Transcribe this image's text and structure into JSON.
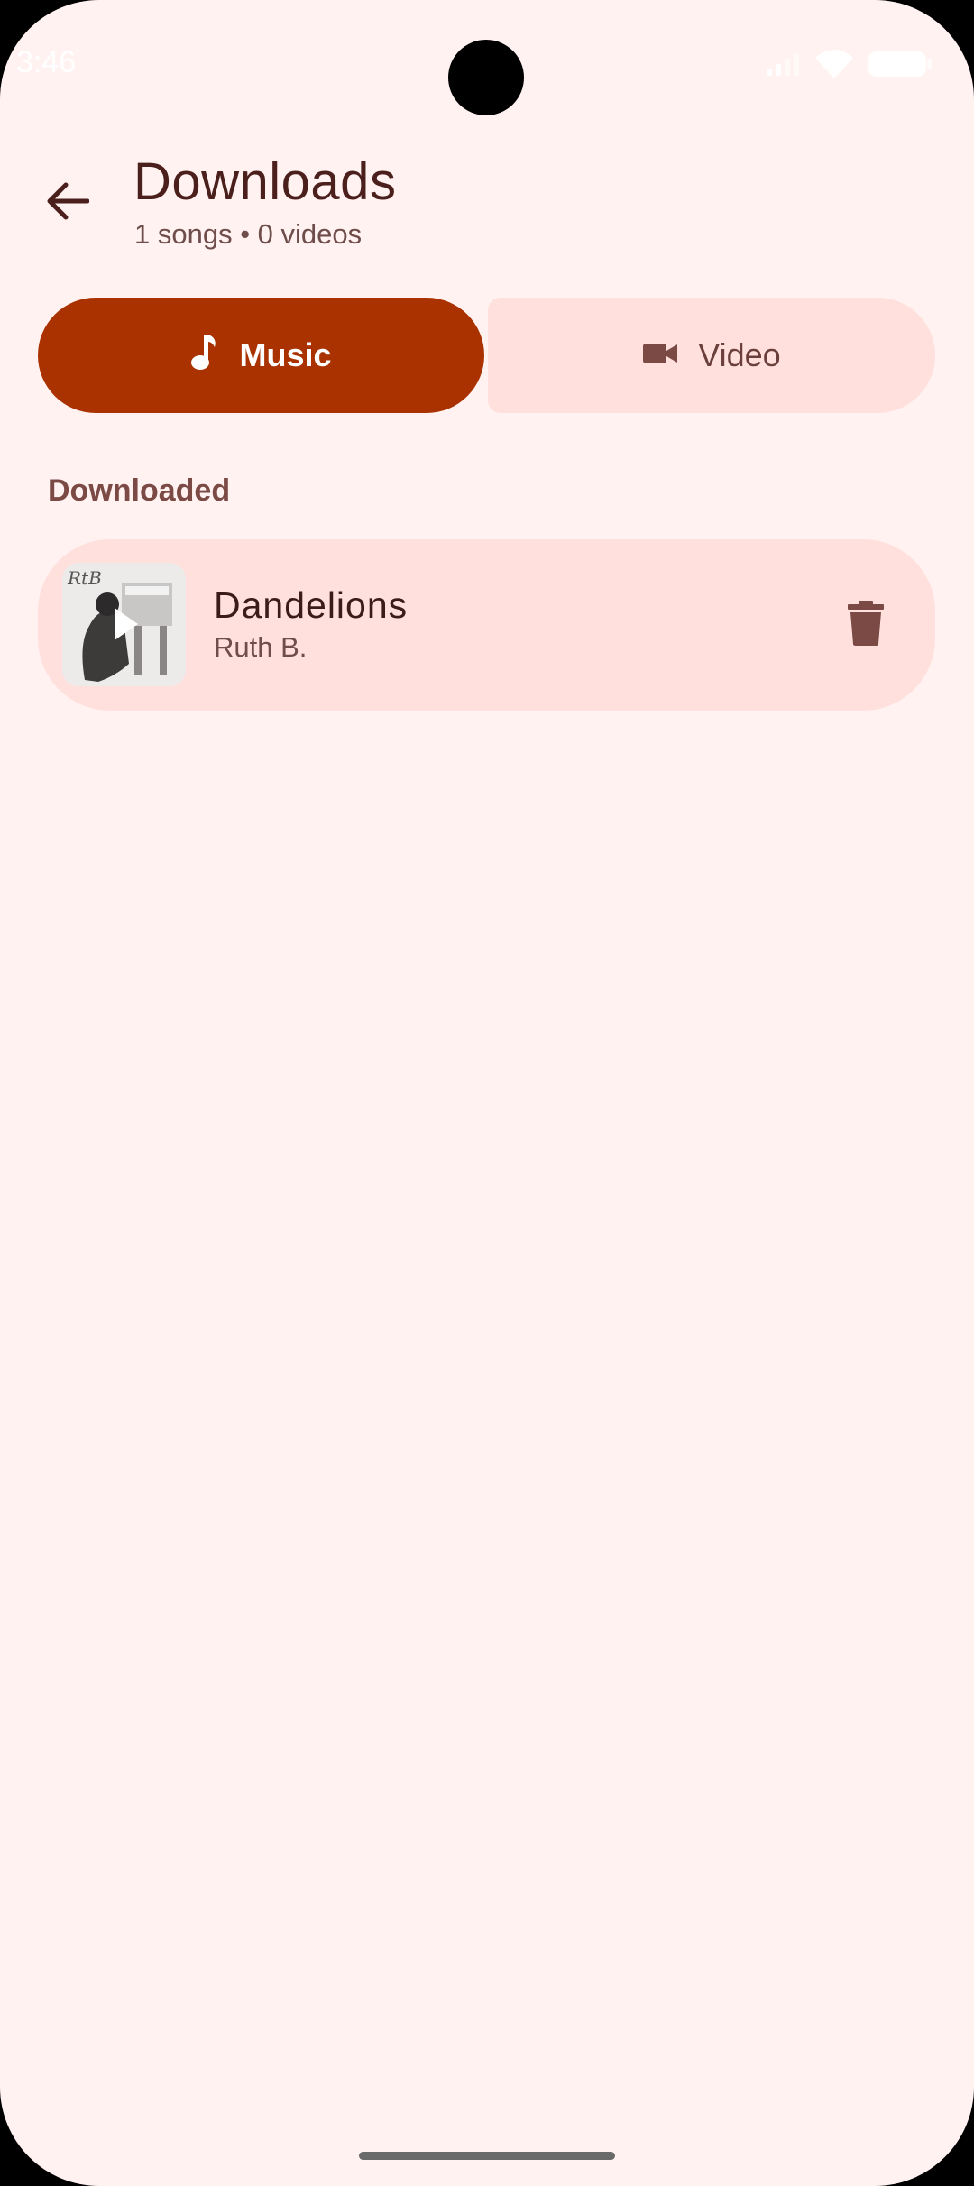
{
  "status_bar": {
    "time": "3:46",
    "icons": [
      "signal-icon",
      "wifi-icon",
      "battery-icon"
    ]
  },
  "header": {
    "title": "Downloads",
    "subtitle": "1 songs • 0 videos",
    "back_icon": "arrow-back-icon"
  },
  "tabs": [
    {
      "label": "Music",
      "icon": "music-note-icon",
      "selected": true
    },
    {
      "label": "Video",
      "icon": "videocam-icon",
      "selected": false
    }
  ],
  "section": {
    "label": "Downloaded"
  },
  "items": [
    {
      "title": "Dandelions",
      "artist": "Ruth B.",
      "thumbnail_icon": "album-art-icon",
      "action_icon": "delete-icon"
    }
  ],
  "colors": {
    "background": "#fff2f1",
    "accent": "#a93200",
    "surface": "#ffe0dc",
    "title_text": "#4a1f1c",
    "secondary_text": "#6e4d4a",
    "icon": "#7b4a45"
  }
}
